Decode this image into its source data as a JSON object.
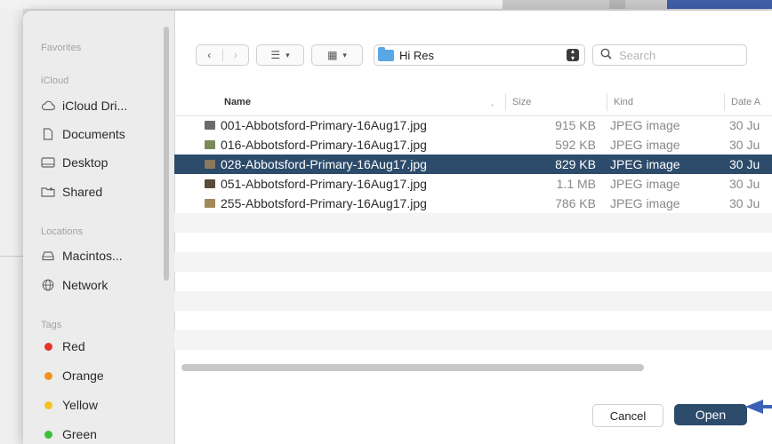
{
  "sidebar": {
    "sections": [
      {
        "label": "Favorites"
      },
      {
        "label": "iCloud"
      },
      {
        "label": "Locations"
      },
      {
        "label": "Tags"
      }
    ],
    "items": [
      {
        "label": "iCloud Dri...",
        "icon": "cloud-icon"
      },
      {
        "label": "Documents",
        "icon": "document-icon"
      },
      {
        "label": "Desktop",
        "icon": "desktop-icon"
      },
      {
        "label": "Shared",
        "icon": "shared-folder-icon"
      },
      {
        "label": "Macintos...",
        "icon": "disk-icon"
      },
      {
        "label": "Network",
        "icon": "network-icon"
      }
    ],
    "tags": [
      {
        "label": "Red",
        "color": "#e8332c"
      },
      {
        "label": "Orange",
        "color": "#f3921f"
      },
      {
        "label": "Yellow",
        "color": "#f5c223"
      },
      {
        "label": "Green",
        "color": "#3bbf3b"
      }
    ]
  },
  "toolbar": {
    "location": "Hi Res",
    "search_placeholder": "Search"
  },
  "columns": {
    "name": "Name",
    "size": "Size",
    "kind": "Kind",
    "date": "Date A"
  },
  "files": [
    {
      "name": "001-Abbotsford-Primary-16Aug17.jpg",
      "size": "915 KB",
      "kind": "JPEG image",
      "date": "30 Ju",
      "thumb": "#6b6b6b"
    },
    {
      "name": "016-Abbotsford-Primary-16Aug17.jpg",
      "size": "592 KB",
      "kind": "JPEG image",
      "date": "30 Ju",
      "thumb": "#7a8a5a"
    },
    {
      "name": "028-Abbotsford-Primary-16Aug17.jpg",
      "size": "829 KB",
      "kind": "JPEG image",
      "date": "30 Ju",
      "thumb": "#8a7a5a"
    },
    {
      "name": "051-Abbotsford-Primary-16Aug17.jpg",
      "size": "1.1 MB",
      "kind": "JPEG image",
      "date": "30 Ju",
      "thumb": "#5a4a3a"
    },
    {
      "name": "255-Abbotsford-Primary-16Aug17.jpg",
      "size": "786 KB",
      "kind": "JPEG image",
      "date": "30 Ju",
      "thumb": "#a08a5a"
    }
  ],
  "buttons": {
    "cancel": "Cancel",
    "open": "Open"
  }
}
